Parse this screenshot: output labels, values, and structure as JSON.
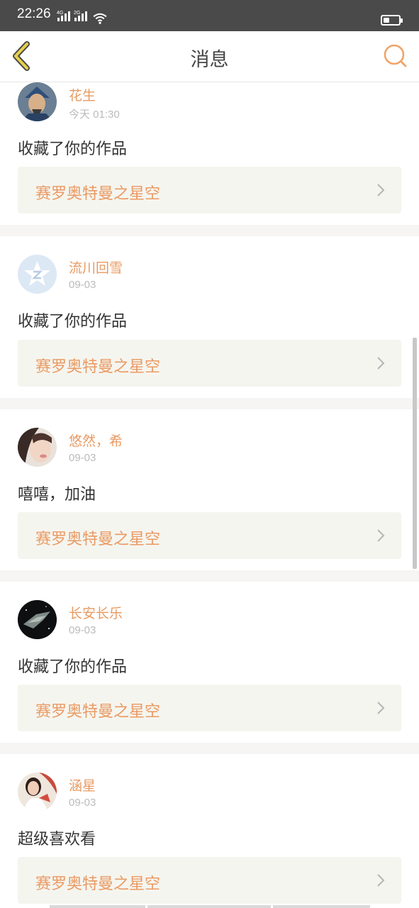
{
  "status": {
    "time": "22:26",
    "net1": "4G",
    "net2": "2G",
    "battery_level": 0.4
  },
  "header": {
    "title": "消息"
  },
  "messages": [
    {
      "user": "花生",
      "date": "今天 01:30",
      "text": "收藏了你的作品",
      "work": "赛罗奥特曼之星空",
      "avatar_icon": "warrior-avatar"
    },
    {
      "user": "流川回雪",
      "date": "09-03",
      "text": "收藏了你的作品",
      "work": "赛罗奥特曼之星空",
      "avatar_icon": "default-star-avatar"
    },
    {
      "user": "悠然，希",
      "date": "09-03",
      "text": "嘻嘻，加油",
      "work": "赛罗奥特曼之星空",
      "avatar_icon": "girl-portrait-avatar"
    },
    {
      "user": "长安长乐",
      "date": "09-03",
      "text": "收藏了你的作品",
      "work": "赛罗奥特曼之星空",
      "avatar_icon": "spaceship-avatar"
    },
    {
      "user": "涵星",
      "date": "09-03",
      "text": "超级喜欢看",
      "work": "赛罗奥特曼之星空",
      "avatar_icon": "girl-photo-avatar"
    }
  ],
  "colors": {
    "accent": "#e89a62",
    "card_bg": "#f5f5ef",
    "statusbar_bg": "#4a4a4a"
  }
}
